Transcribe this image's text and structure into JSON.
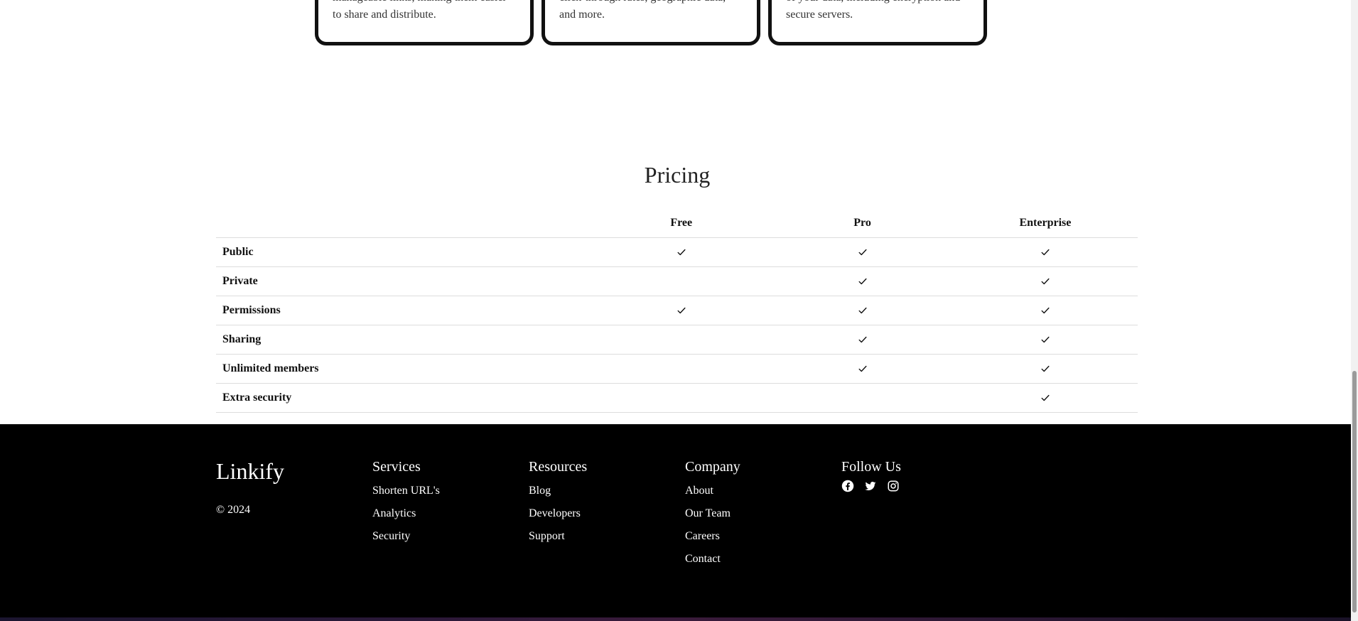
{
  "cards": [
    {
      "text": "manageable links, making them easier to share and distribute."
    },
    {
      "text": "URLs with detailed analytics, including click-through rates, geographic data, and more."
    },
    {
      "text": "protect your links and ensure the safety of your data, including encryption and secure servers."
    }
  ],
  "pricing": {
    "title": "Pricing",
    "plans": [
      "Free",
      "Pro",
      "Enterprise"
    ],
    "rows": [
      {
        "feature": "Public",
        "free": true,
        "pro": true,
        "enterprise": true
      },
      {
        "feature": "Private",
        "free": false,
        "pro": true,
        "enterprise": true
      },
      {
        "feature": "Permissions",
        "free": true,
        "pro": true,
        "enterprise": true
      },
      {
        "feature": "Sharing",
        "free": false,
        "pro": true,
        "enterprise": true
      },
      {
        "feature": "Unlimited members",
        "free": false,
        "pro": true,
        "enterprise": true
      },
      {
        "feature": "Extra security",
        "free": false,
        "pro": false,
        "enterprise": true
      }
    ]
  },
  "footer": {
    "brand": "Linkify",
    "copyright": "© 2024",
    "services": {
      "title": "Services",
      "links": [
        "Shorten URL's",
        "Analytics",
        "Security"
      ]
    },
    "resources": {
      "title": "Resources",
      "links": [
        "Blog",
        "Developers",
        "Support"
      ]
    },
    "company": {
      "title": "Company",
      "links": [
        "About",
        "Our Team",
        "Careers",
        "Contact"
      ]
    },
    "follow": {
      "title": "Follow Us",
      "icons": [
        "facebook-icon",
        "twitter-icon",
        "instagram-icon"
      ]
    },
    "colors": {
      "background": "#000000",
      "text": "#ffffff"
    }
  }
}
